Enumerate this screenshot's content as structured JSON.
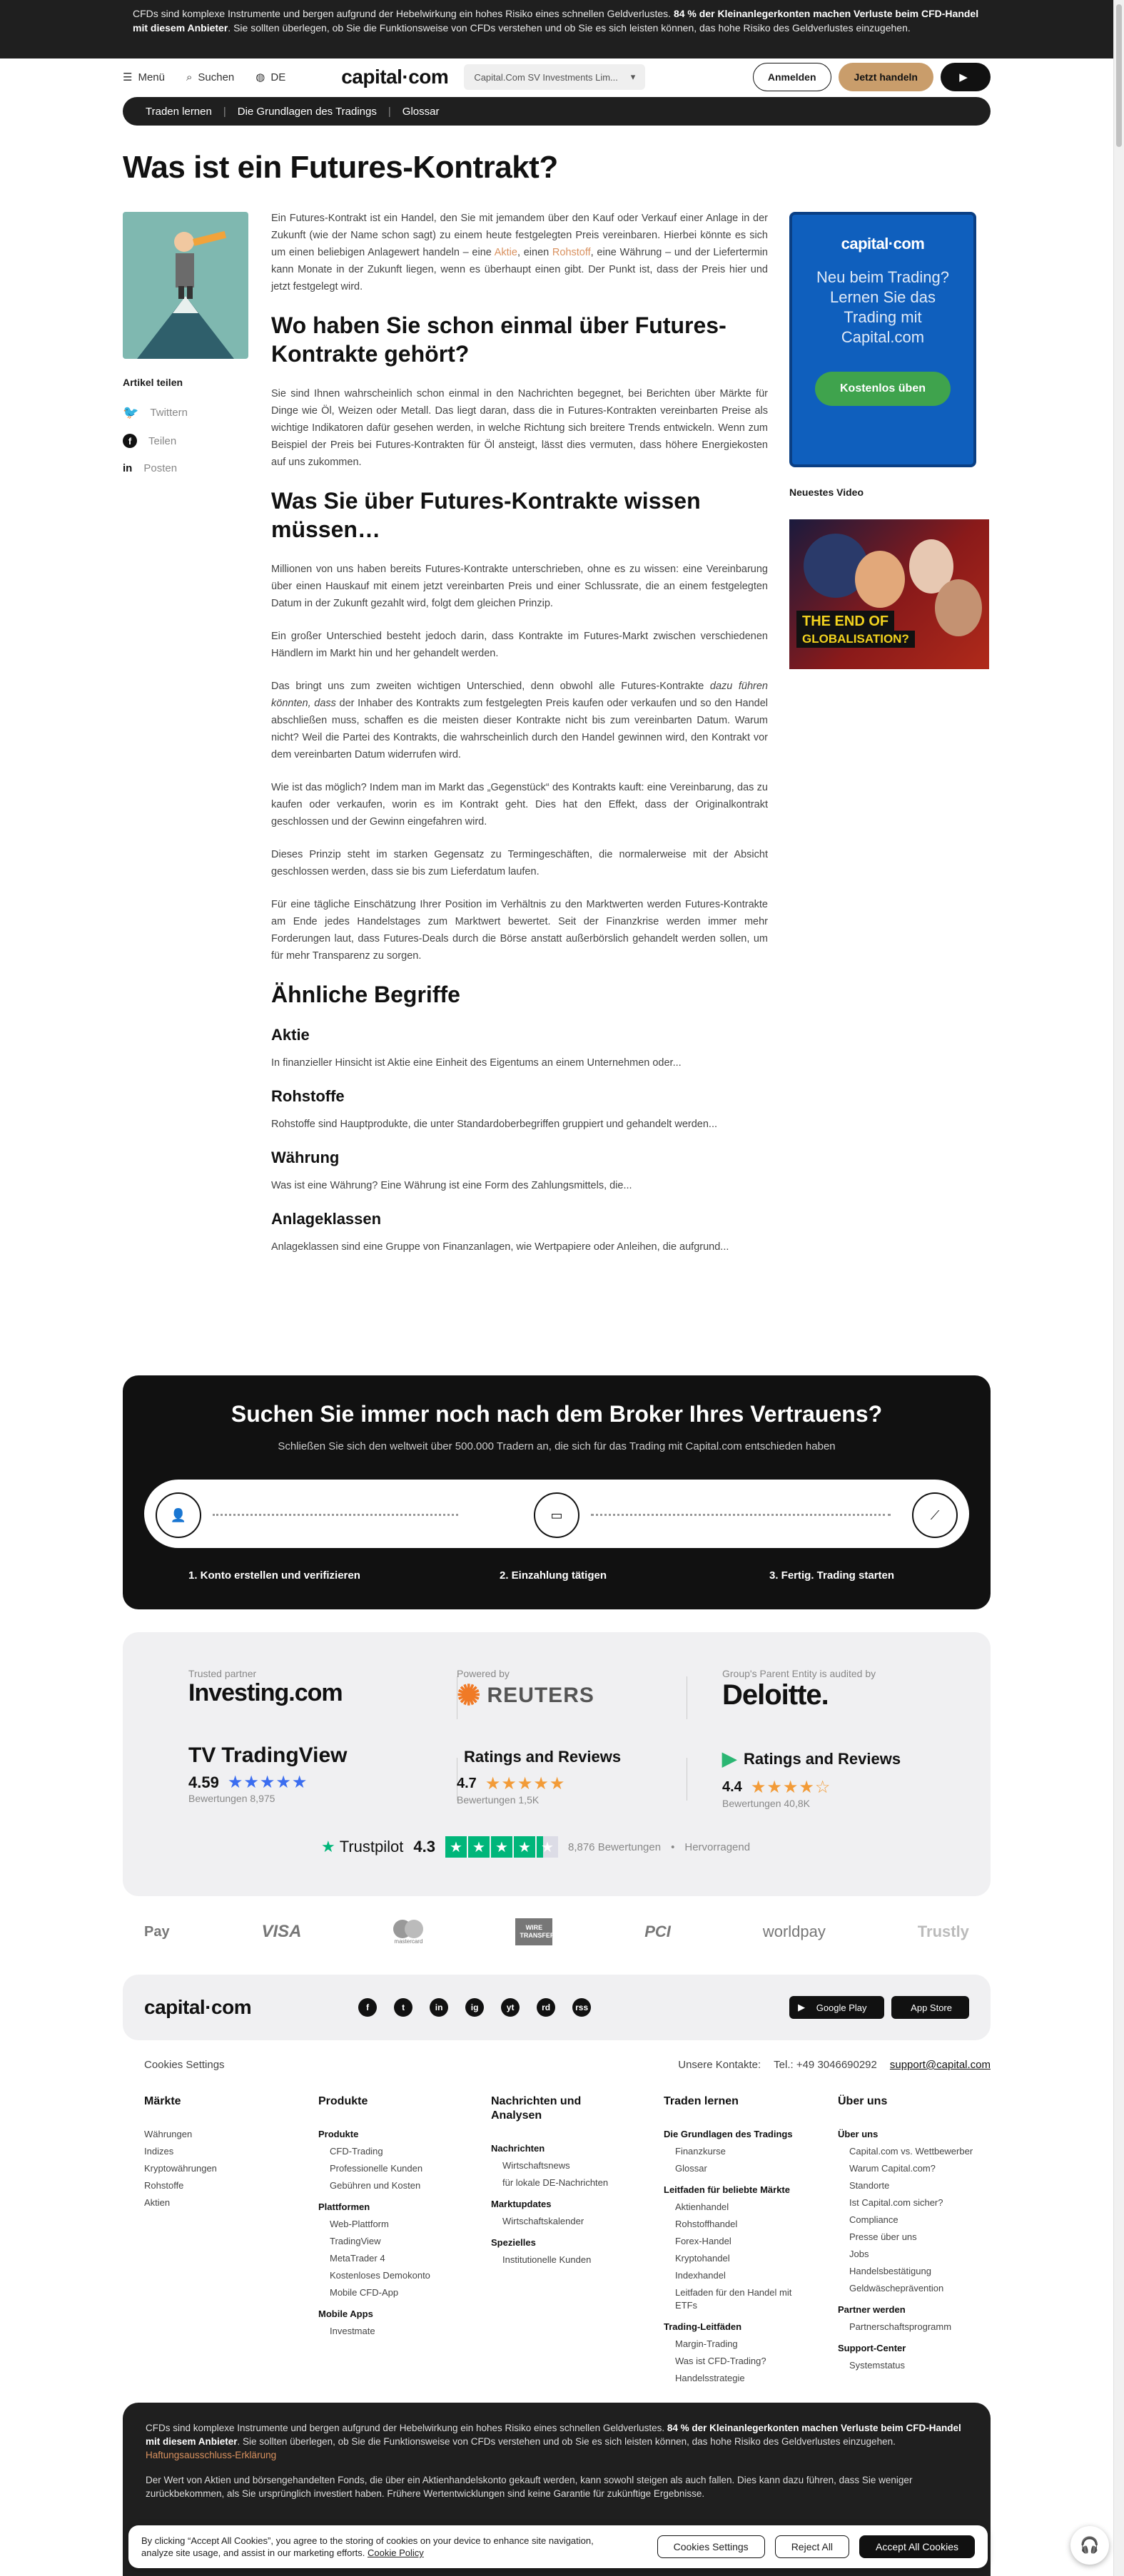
{
  "risk_top": {
    "text1": "CFDs sind komplexe Instrumente und bergen aufgrund der Hebelwirkung ein hohes Risiko eines schnellen Geldverlustes. ",
    "bold": "84 % der Kleinanlegerkonten machen Verluste beim CFD-Handel mit diesem Anbieter",
    "text2": ". Sie sollten überlegen, ob Sie die Funktionsweise von CFDs verstehen und ob Sie es sich leisten können, das hohe Risiko des Geldverlustes einzugehen."
  },
  "nav": {
    "menu": "Menü",
    "search": "Suchen",
    "lang": "DE",
    "logo": "capital·com",
    "entity": "Capital.Com SV Investments Lim...",
    "login": "Anmelden",
    "trade": "Jetzt handeln"
  },
  "breadcrumb": [
    "Traden lernen",
    "Die Grundlagen des Tradings",
    "Glossar"
  ],
  "page_title": "Was ist ein Futures-Kontrakt?",
  "share": {
    "title": "Artikel teilen",
    "twitter": "Twittern",
    "facebook": "Teilen",
    "linkedin": "Posten"
  },
  "article": {
    "p1a": "Ein Futures-Kontrakt ist ein Handel, den Sie mit jemandem über den Kauf oder Verkauf einer Anlage in der Zukunft (wie der Name schon sagt) zu einem heute festgelegten Preis vereinbaren. Hierbei könnte es sich um einen beliebigen Anlagewert handeln – eine ",
    "p1l1": "Aktie",
    "p1b": ", einen ",
    "p1l2": "Rohstoff",
    "p1c": ", eine Währung – und der Liefertermin kann Monate in der Zukunft liegen, wenn es überhaupt einen gibt. Der Punkt ist, dass der Preis hier und jetzt festgelegt wird.",
    "h2a": "Wo haben Sie schon einmal über Futures-Kontrakte gehört?",
    "p2": "Sie sind Ihnen wahrscheinlich schon einmal in den Nachrichten begegnet, bei Berichten über Märkte für Dinge wie Öl, Weizen oder Metall. Das liegt daran, dass die in Futures-Kontrakten vereinbarten Preise als wichtige Indikatoren dafür gesehen werden, in welche Richtung sich breitere Trends entwickeln. Wenn zum Beispiel der Preis bei Futures-Kontrakten für Öl ansteigt, lässt dies vermuten, dass höhere Energiekosten auf uns zukommen.",
    "h2b": "Was Sie über Futures-Kontrakte wissen müssen…",
    "p3": "Millionen von uns haben bereits Futures-Kontrakte unterschrieben, ohne es zu wissen: eine Vereinbarung über einen Hauskauf mit einem jetzt vereinbarten Preis und einer Schlussrate, die an einem festgelegten Datum in der Zukunft gezahlt wird, folgt dem gleichen Prinzip.",
    "p4": "Ein großer Unterschied besteht jedoch darin, dass Kontrakte im Futures-Markt zwischen verschiedenen Händlern im Markt hin und her gehandelt werden.",
    "p5a": "Das bringt uns zum zweiten wichtigen Unterschied, denn obwohl alle Futures-Kontrakte ",
    "p5i": "dazu führen könnten, dass",
    "p5b": " der Inhaber des Kontrakts zum festgelegten Preis kaufen oder verkaufen und so den Handel abschließen muss, schaffen es die meisten dieser Kontrakte nicht bis zum vereinbarten Datum. Warum nicht? Weil die Partei des Kontrakts, die wahrscheinlich durch den Handel gewinnen wird, den Kontrakt vor dem vereinbarten Datum widerrufen wird.",
    "p6": "Wie ist das möglich? Indem man im Markt das „Gegenstück“ des Kontrakts kauft: eine Vereinbarung, das zu kaufen oder verkaufen, worin es im Kontrakt geht. Dies hat den Effekt, dass der Originalkontrakt geschlossen und der Gewinn eingefahren wird.",
    "p7": "Dieses Prinzip steht im starken Gegensatz zu Termingeschäften, die normalerweise mit der Absicht geschlossen werden, dass sie bis zum Lieferdatum laufen.",
    "p8": "Für eine tägliche Einschätzung Ihrer Position im Verhältnis zu den Marktwerten werden Futures-Kontrakte am Ende jedes Handelstages zum Marktwert bewertet. Seit der Finanzkrise werden immer mehr Forderungen laut, dass Futures-Deals durch die Börse anstatt außerbörslich gehandelt werden sollen, um für mehr Transparenz zu sorgen.",
    "h2c": "Ähnliche Begriffe",
    "terms": [
      {
        "t": "Aktie",
        "d": "In finanzieller Hinsicht ist Aktie eine Einheit des Eigentums an einem Unternehmen oder..."
      },
      {
        "t": "Rohstoffe",
        "d": "Rohstoffe sind Hauptprodukte, die unter Standardoberbegriffen gruppiert und gehandelt werden..."
      },
      {
        "t": "Währung",
        "d": "Was ist eine Währung? Eine Währung ist eine Form des Zahlungsmittels, die..."
      },
      {
        "t": "Anlageklassen",
        "d": "Anlageklassen sind eine Gruppe von Finanzanlagen, wie Wertpapiere oder Anleihen, die aufgrund..."
      }
    ]
  },
  "ad": {
    "logo": "capital·com",
    "text": "Neu beim Trading? Lernen Sie das Trading mit Capital.com",
    "cta": "Kostenlos üben"
  },
  "video": {
    "title": "Neuestes Video",
    "cap1": "THE END OF",
    "cap2": "GLOBALISATION?"
  },
  "broker": {
    "title": "Suchen Sie immer noch nach dem Broker Ihres Vertrauens?",
    "sub": "Schließen Sie sich den weltweit über 500.000 Tradern an, die sich für das Trading mit Capital.com entschieden haben",
    "steps": [
      "1. Konto erstellen und verifizieren",
      "2. Einzahlung tätigen",
      "3. Fertig. Trading starten"
    ]
  },
  "trust": {
    "partner_label": "Trusted partner",
    "partner": "Investing.com",
    "powered_label": "Powered by",
    "powered": "REUTERS",
    "audit_label": "Group's Parent Entity is audited by",
    "audit": "Deloitte.",
    "tv_name": "TradingView",
    "tv_score": "4.59",
    "tv_count": "Bewertungen 8,975",
    "apple_name": "Ratings and Reviews",
    "apple_score": "4.7",
    "apple_count": "Bewertungen 1,5K",
    "gp_name": "Ratings and Reviews",
    "gp_score": "4.4",
    "gp_count": "Bewertungen 40,8K",
    "tp_name": "Trustpilot",
    "tp_score": "4.3",
    "tp_count": "8,876 Bewertungen",
    "tp_label": "Hervorragend"
  },
  "payments": [
    "Pay",
    "VISA",
    "mastercard",
    "WIRE TRANSFER",
    "PCI",
    "worldpay",
    "Trustly"
  ],
  "footer": {
    "logo": "capital·com",
    "social": [
      "f",
      "t",
      "in",
      "ig",
      "yt",
      "rd",
      "rss"
    ],
    "stores": [
      "Google Play",
      "App Store"
    ],
    "cookies": "Cookies Settings",
    "contacts": "Unsere Kontakte:",
    "phone": "Tel.: +49 3046690292",
    "email": "support@capital.com",
    "cols": [
      {
        "h": "Märkte",
        "items": [
          "Währungen",
          "Indizes",
          "Kryptowährungen",
          "Rohstoffe",
          "Aktien"
        ]
      },
      {
        "h": "Produkte",
        "groups": [
          {
            "g": "Produkte",
            "items": [
              "CFD-Trading",
              "Professionelle Kunden",
              "Gebühren und Kosten"
            ]
          },
          {
            "g": "Plattformen",
            "items": [
              "Web-Plattform",
              "TradingView",
              "MetaTrader 4",
              "Kostenloses Demokonto",
              "Mobile CFD-App"
            ]
          },
          {
            "g": "Mobile Apps",
            "items": [
              "Investmate"
            ]
          }
        ]
      },
      {
        "h": "Nachrichten und Analysen",
        "groups": [
          {
            "g": "Nachrichten",
            "items": [
              "Wirtschaftsnews",
              "für lokale DE-Nachrichten"
            ]
          },
          {
            "g": "Marktupdates",
            "items": [
              "Wirtschaftskalender"
            ]
          },
          {
            "g": "Spezielles",
            "items": [
              "Institutionelle Kunden"
            ]
          }
        ]
      },
      {
        "h": "Traden lernen",
        "groups": [
          {
            "g": "Die Grundlagen des Tradings",
            "items": [
              "Finanzkurse",
              "Glossar"
            ]
          },
          {
            "g": "Leitfaden für beliebte Märkte",
            "items": [
              "Aktienhandel",
              "Rohstoffhandel",
              "Forex-Handel",
              "Kryptohandel",
              "Indexhandel",
              "Leitfaden für den Handel mit ETFs"
            ]
          },
          {
            "g": "Trading-Leitfäden",
            "items": [
              "Margin-Trading",
              "Was ist CFD-Trading?",
              "Handelsstrategie"
            ]
          }
        ]
      },
      {
        "h": "Über uns",
        "groups": [
          {
            "g": "Über uns",
            "items": [
              "Capital.com vs. Wettbewerber",
              "Warum Capital.com?",
              "Standorte",
              "Ist Capital.com sicher?",
              "Compliance",
              "Presse über uns",
              "Jobs",
              "Handelsbestätigung",
              "Geldwäscheprävention"
            ]
          },
          {
            "g": "Partner werden",
            "items": [
              "Partnerschaftsprogramm"
            ]
          },
          {
            "g": "Support-Center",
            "items": [
              "Systemstatus"
            ]
          }
        ]
      }
    ]
  },
  "risk_bottom": {
    "text1": "CFDs sind komplexe Instrumente und bergen aufgrund der Hebelwirkung ein hohes Risiko eines schnellen Geldverlustes. ",
    "bold": "84 % der Kleinanlegerkonten machen Verluste beim CFD-Handel mit diesem Anbieter",
    "text2": ". Sie sollten überlegen, ob Sie die Funktionsweise von CFDs verstehen und ob Sie es sich leisten können, das hohe Risiko des Geldverlustes einzugehen. ",
    "link": "Haftungsausschluss-Erklärung",
    "p2": "Der Wert von Aktien und börsengehandelten Fonds, die über ein Aktienhandelskonto gekauft werden, kann sowohl steigen als auch fallen. Dies kann dazu führen, dass Sie weniger zurückbekommen, als Sie ursprünglich investiert haben. Frühere Wertentwicklungen sind keine Garantie für zukünftige Ergebnisse."
  },
  "cookie": {
    "text": "By clicking “Accept All Cookies”, you agree to the storing of cookies on your device to enhance site navigation, analyze site usage, and assist in our marketing efforts.",
    "policy": "Cookie Policy",
    "settings": "Cookies Settings",
    "reject": "Reject All",
    "accept": "Accept All Cookies"
  }
}
